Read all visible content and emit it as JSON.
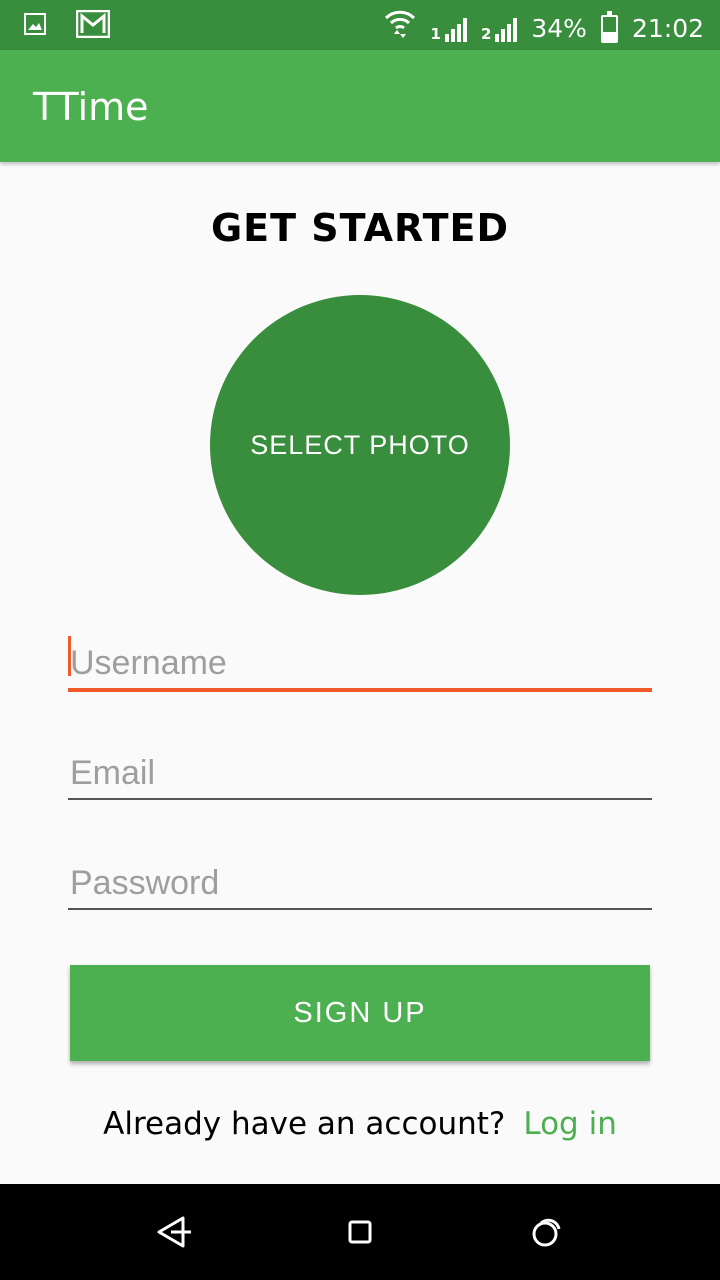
{
  "status_bar": {
    "battery_percent_label": "34%",
    "battery_level": 0.34,
    "time": "21:02",
    "sim1_label": "1",
    "sim2_label": "2",
    "icons": [
      "image-icon",
      "gmail-icon",
      "wifi-icon",
      "signal-sim1-icon",
      "signal-sim2-icon",
      "battery-icon"
    ]
  },
  "app_bar": {
    "title": "TTime"
  },
  "main": {
    "heading": "GET STARTED",
    "photo_button_label": "SELECT PHOTO",
    "username": {
      "value": "",
      "placeholder": "Username"
    },
    "email": {
      "value": "",
      "placeholder": "Email"
    },
    "password": {
      "value": "",
      "placeholder": "Password"
    },
    "signup_label": "SIGN UP",
    "login_prompt": "Already have an account?",
    "login_link": "Log in"
  },
  "nav_bar": {
    "icons": [
      "back-icon",
      "home-icon",
      "recents-icon"
    ]
  },
  "colors": {
    "primary": "#4caf50",
    "primary_dark": "#388e3c",
    "accent": "#f05a28",
    "background": "#fafafa"
  }
}
